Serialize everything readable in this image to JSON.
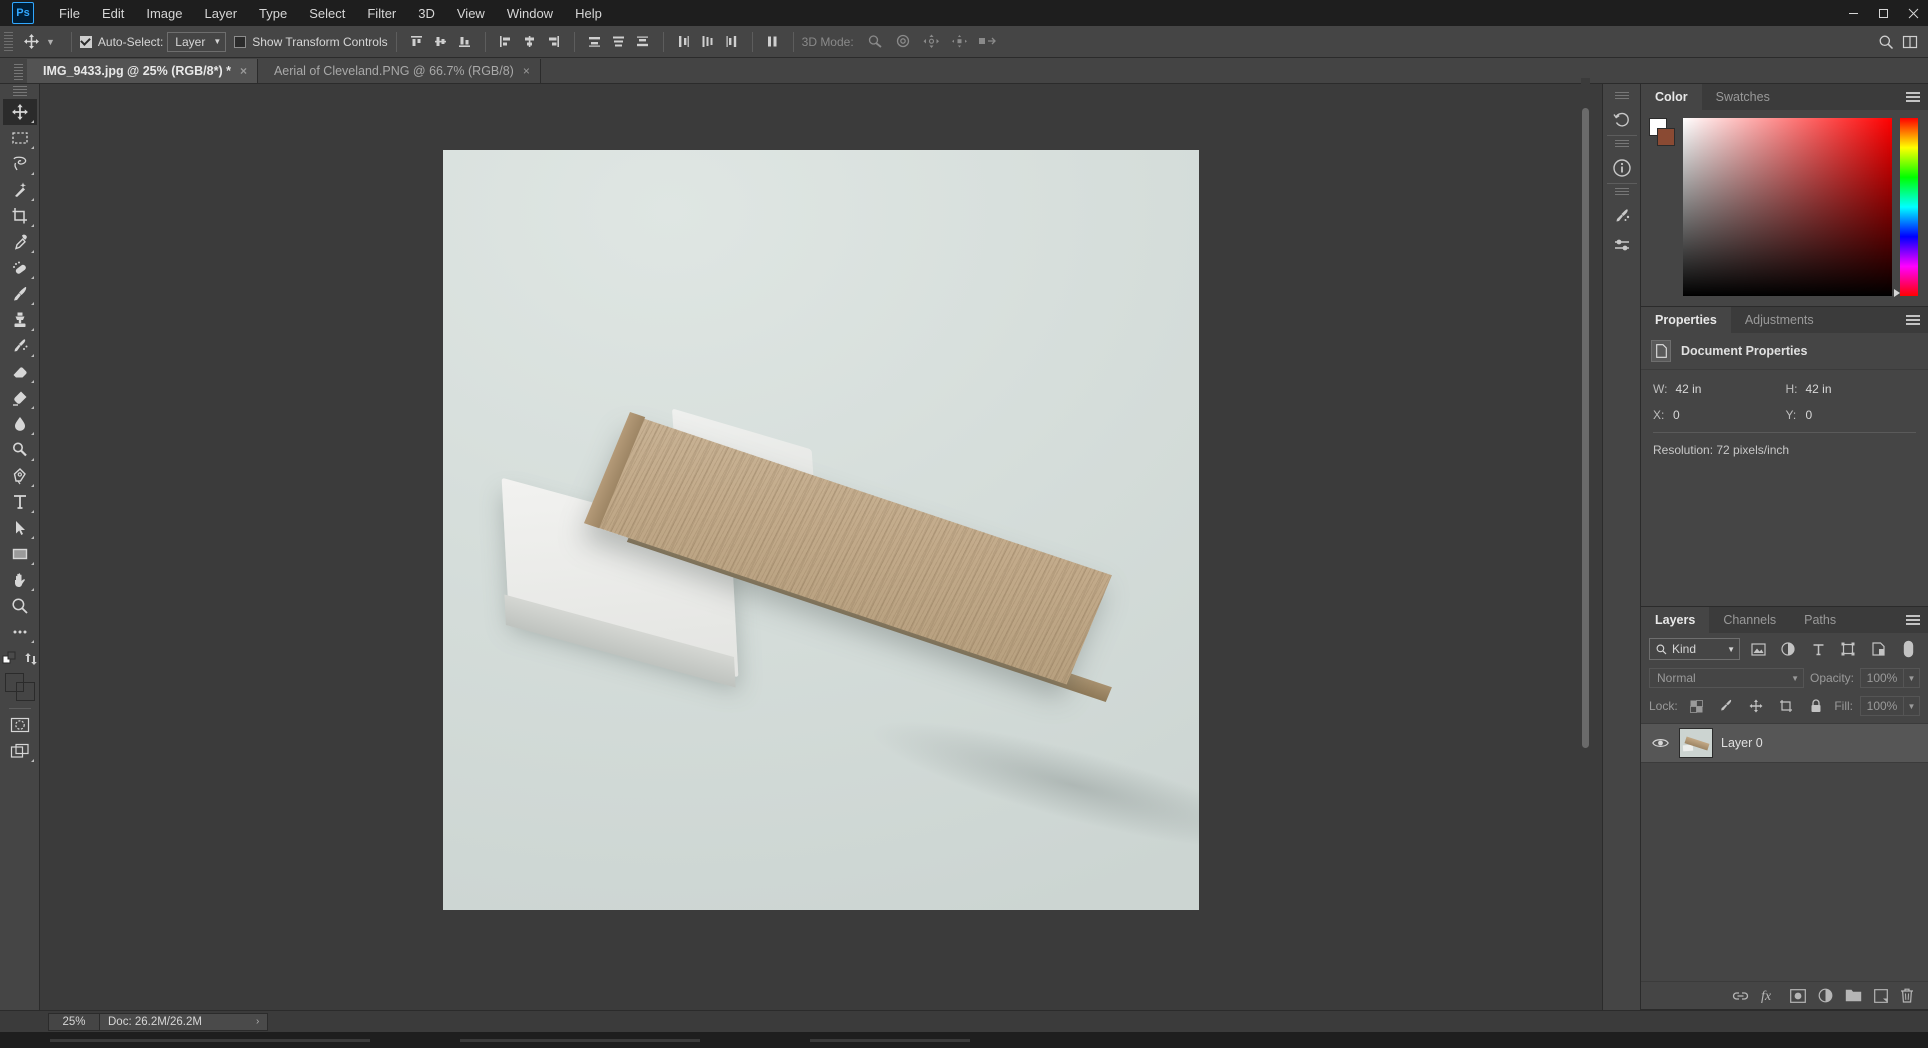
{
  "app": {
    "name": "Ps",
    "window_controls": [
      "minimize",
      "maximize",
      "close"
    ]
  },
  "menubar": {
    "items": [
      "File",
      "Edit",
      "Image",
      "Layer",
      "Type",
      "Select",
      "Filter",
      "3D",
      "View",
      "Window",
      "Help"
    ]
  },
  "options_bar": {
    "tool_icon": "move-tool-icon",
    "auto_select_label": "Auto-Select:",
    "auto_select_checked": true,
    "auto_select_value": "Layer",
    "auto_select_options": [
      "Layer",
      "Group"
    ],
    "show_transform_label": "Show Transform Controls",
    "show_transform_checked": false,
    "align_group_1": [
      "align-top-edges-icon",
      "align-vertical-centers-icon",
      "align-bottom-edges-icon"
    ],
    "align_group_2": [
      "align-left-edges-icon",
      "align-horizontal-centers-icon",
      "align-right-edges-icon"
    ],
    "distribute_group_1": [
      "distribute-top-edges-icon",
      "distribute-vertical-centers-icon",
      "distribute-bottom-edges-icon"
    ],
    "distribute_group_2": [
      "distribute-left-edges-icon",
      "distribute-horizontal-centers-icon",
      "distribute-right-edges-icon"
    ],
    "distribute_spacing": "distribute-spacing-icon",
    "mode_3d_label": "3D Mode:",
    "mode_3d_icons": [
      "orbit-3d-icon",
      "roll-3d-icon",
      "pan-3d-icon",
      "slide-3d-icon",
      "scale-3d-icon"
    ],
    "search_icon": "search-icon",
    "arrange_icon": "arrange-documents-icon"
  },
  "tabs": [
    {
      "label": "IMG_9433.jpg @ 25% (RGB/8*) *",
      "active": true,
      "close": "×"
    },
    {
      "label": "Aerial of Cleveland.PNG @ 66.7% (RGB/8)",
      "active": false,
      "close": "×"
    }
  ],
  "toolbar": {
    "tools": [
      {
        "name": "move-tool",
        "active": true
      },
      {
        "name": "rectangular-marquee-tool",
        "active": false
      },
      {
        "name": "lasso-tool",
        "active": false
      },
      {
        "name": "magic-wand-tool",
        "active": false
      },
      {
        "name": "crop-tool",
        "active": false
      },
      {
        "name": "eyedropper-tool",
        "active": false
      },
      {
        "name": "spot-healing-brush-tool",
        "active": false
      },
      {
        "name": "brush-tool",
        "active": false
      },
      {
        "name": "clone-stamp-tool",
        "active": false
      },
      {
        "name": "history-brush-tool",
        "active": false
      },
      {
        "name": "eraser-tool",
        "active": false
      },
      {
        "name": "gradient-tool",
        "active": false
      },
      {
        "name": "blur-tool",
        "active": false
      },
      {
        "name": "dodge-tool",
        "active": false
      },
      {
        "name": "pen-tool",
        "active": false
      },
      {
        "name": "horizontal-type-tool",
        "active": false
      },
      {
        "name": "path-selection-tool",
        "active": false
      },
      {
        "name": "rectangle-tool",
        "active": false
      },
      {
        "name": "hand-tool",
        "active": false
      },
      {
        "name": "zoom-tool",
        "active": false
      },
      {
        "name": "edit-toolbar-tool",
        "active": false
      }
    ],
    "foreground_color": "#ffffff",
    "background_color": "#8a4a33",
    "quick_mask": "quick-mask-mode-icon",
    "screen_mode": "screen-mode-icon"
  },
  "icon_dock": {
    "items": [
      "history-icon",
      "info-icon",
      "brush-settings-icon",
      "adjustments-icon"
    ]
  },
  "color_panel": {
    "tabs": [
      {
        "label": "Color",
        "active": true
      },
      {
        "label": "Swatches",
        "active": false
      }
    ],
    "foreground_color": "#ffffff",
    "background_color": "#8a4a33",
    "menu_icon": "panel-menu-icon"
  },
  "properties_panel": {
    "tabs": [
      {
        "label": "Properties",
        "active": true
      },
      {
        "label": "Adjustments",
        "active": false
      }
    ],
    "header_icon": "document-icon",
    "header_title": "Document Properties",
    "fields": [
      {
        "key": "W:",
        "value": "42 in"
      },
      {
        "key": "H:",
        "value": "42 in"
      },
      {
        "key": "X:",
        "value": "0"
      },
      {
        "key": "Y:",
        "value": "0"
      }
    ],
    "resolution": "Resolution: 72 pixels/inch",
    "menu_icon": "panel-menu-icon"
  },
  "layers_panel": {
    "tabs": [
      {
        "label": "Layers",
        "active": true
      },
      {
        "label": "Channels",
        "active": false
      },
      {
        "label": "Paths",
        "active": false
      }
    ],
    "filter_label": "Kind",
    "filter_icons": [
      "filter-pixel-icon",
      "filter-adjustment-icon",
      "filter-type-icon",
      "filter-shape-icon",
      "filter-smart-object-icon",
      "filter-toggle-icon"
    ],
    "blend_mode": "Normal",
    "opacity_label": "Opacity:",
    "opacity_value": "100%",
    "lock_label": "Lock:",
    "lock_icons": [
      "lock-transparency-icon",
      "lock-image-icon",
      "lock-position-icon",
      "lock-artboard-icon",
      "lock-all-icon"
    ],
    "fill_label": "Fill:",
    "fill_value": "100%",
    "layers": [
      {
        "name": "Layer 0",
        "visible": true,
        "selected": true,
        "thumb": "wood-block-thumbnail"
      }
    ],
    "footer_icons": [
      "link-layers-icon",
      "layer-style-fx-icon",
      "add-layer-mask-icon",
      "new-adjustment-layer-icon",
      "new-group-icon",
      "new-layer-icon",
      "delete-layer-icon"
    ],
    "menu_icon": "panel-menu-icon"
  },
  "status_bar": {
    "zoom": "25%",
    "doc_info": "Doc: 26.2M/26.2M",
    "expand_arrow": "›"
  },
  "canvas": {
    "image_alt": "photo-of-wood-plank-and-white-blocks",
    "zoom_level": "25%"
  }
}
